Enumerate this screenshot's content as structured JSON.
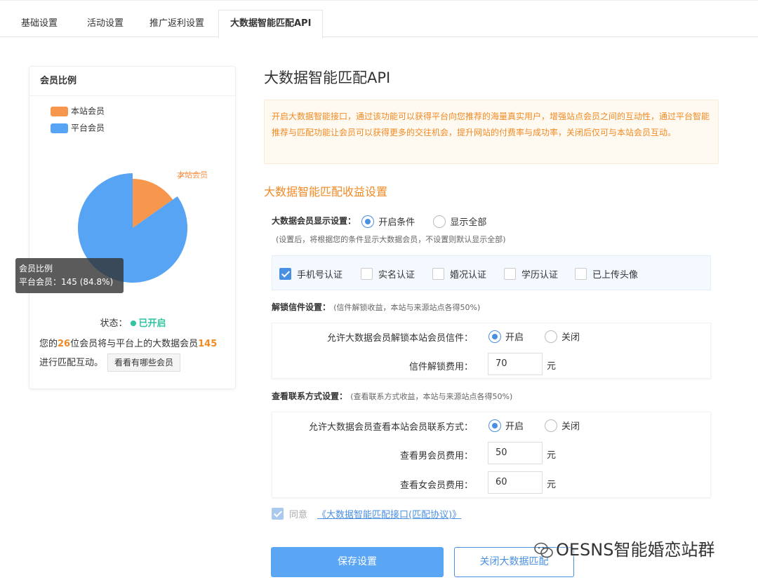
{
  "tabs": [
    {
      "label": "基础设置"
    },
    {
      "label": "活动设置"
    },
    {
      "label": "推广返利设置"
    },
    {
      "label": "大数据智能匹配API"
    }
  ],
  "left_card": {
    "title": "会员比例",
    "status_label": "状态：",
    "status_value": "已开启",
    "info_prefix": "您的",
    "local_count": "26",
    "info_mid": "位会员将与平台上的大数据会员",
    "platform_count": "145",
    "info_suffix": "进行匹配互动。",
    "view_button": "看看有哪些会员",
    "tooltip_title": "会员比例",
    "tooltip_value": "平台会员：145 (84.8%)"
  },
  "chart_data": {
    "type": "pie",
    "title": "会员比例",
    "legend": [
      "本站会员",
      "平台会员"
    ],
    "slices": [
      {
        "name": "本站会员",
        "value": 26,
        "color": "#f7964d"
      },
      {
        "name": "平台会员",
        "value": 145,
        "color": "#57a4f5"
      }
    ],
    "slice_label": "本站会员",
    "highlighted": "平台会员"
  },
  "main": {
    "title": "大数据智能匹配API",
    "notice": "开启大数据智能接口，通过该功能可以获得平台向您推荐的海量真实用户，增强站点会员之间的互动性，通过平台智能推荐与匹配功能让会员可以获得更多的交往机会，提升网站的付费率与成功率，关闭后仅可与本站会员互动。",
    "section_title": "大数据智能匹配收益设置",
    "display": {
      "label": "大数据会员显示设置：",
      "option1": "开启条件",
      "option2": "显示全部",
      "hint": "(设置后，将根据您的条件显示大数据会员，不设置则默认显示全部)"
    },
    "conditions": [
      "手机号认证",
      "实名认证",
      "婚况认证",
      "学历认证",
      "已上传头像"
    ],
    "unlock": {
      "label": "解锁信件设置：",
      "note": "(信件解锁收益，本站与来源站点各得50%)",
      "allow_label": "允许大数据会员解锁本站会员信件：",
      "on": "开启",
      "off": "关闭",
      "fee_label": "信件解锁费用：",
      "fee_value": "70",
      "unit": "元"
    },
    "contact": {
      "label": "查看联系方式设置：",
      "note": "(查看联系方式收益，本站与来源站点各得50%)",
      "allow_label": "允许大数据会员查看本站会员联系方式：",
      "on": "开启",
      "off": "关闭",
      "male_label": "查看男会员费用：",
      "male_value": "50",
      "female_label": "查看女会员费用：",
      "female_value": "60",
      "unit": "元"
    },
    "agree_text": "同意",
    "agree_link": "《大数据智能匹配接口(匹配协议)》",
    "save_button": "保存设置",
    "close_button": "关闭大数据匹配"
  },
  "watermark": "OESNS智能婚恋站群"
}
